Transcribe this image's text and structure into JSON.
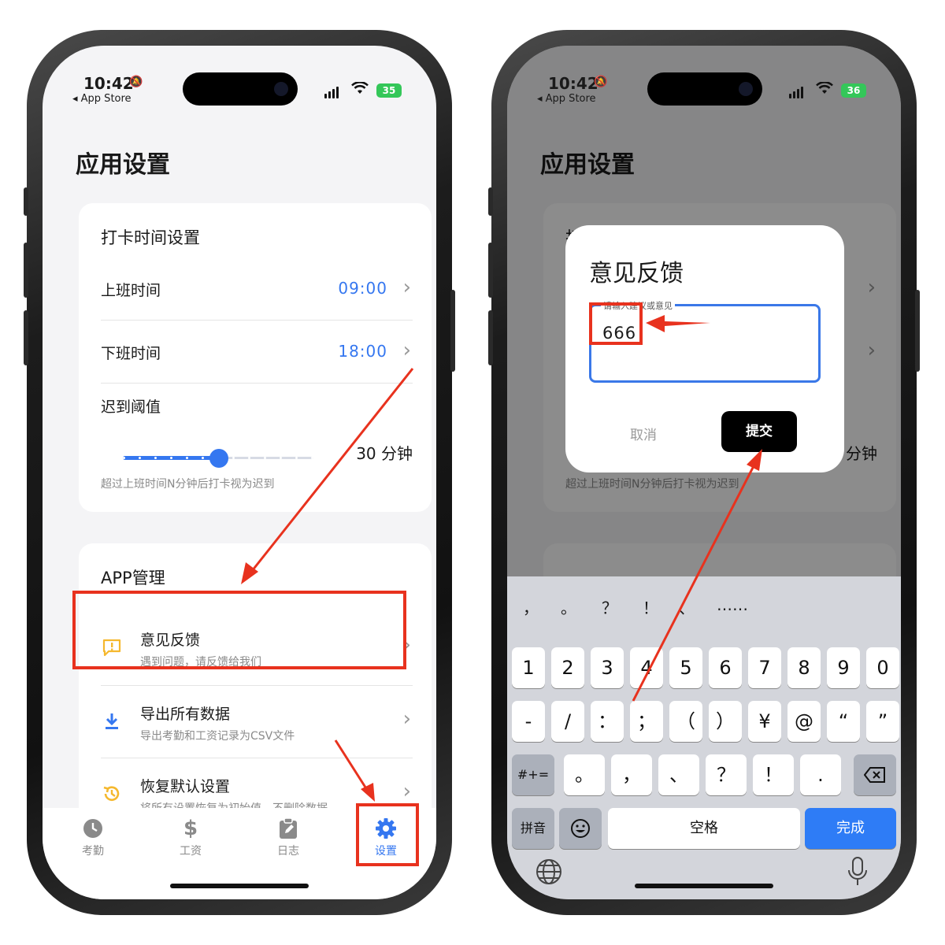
{
  "status_left": {
    "time": "10:42",
    "back": "◂ App Store",
    "battery": "35"
  },
  "status_right": {
    "time": "10:42",
    "back": "◂ App Store",
    "battery": "36"
  },
  "page": {
    "title": "应用设置"
  },
  "punch_card": {
    "title": "打卡时间设置",
    "rows": [
      {
        "label": "上班时间",
        "value": "09:00"
      },
      {
        "label": "下班时间",
        "value": "18:00"
      }
    ],
    "late": {
      "label": "迟到阈值",
      "value": "30 分钟",
      "hint": "超过上班时间N分钟后打卡视为迟到",
      "slider_fraction": 0.5
    }
  },
  "app_card": {
    "title": "APP管理",
    "items": [
      {
        "title": "意见反馈",
        "subtitle": "遇到问题，请反馈给我们"
      },
      {
        "title": "导出所有数据",
        "subtitle": "导出考勤和工资记录为CSV文件"
      },
      {
        "title": "恢复默认设置",
        "subtitle": "将所有设置恢复为初始值，不删除数据"
      }
    ]
  },
  "tabs": [
    {
      "label": "考勤"
    },
    {
      "label": "工资"
    },
    {
      "label": "日志"
    },
    {
      "label": "设置"
    }
  ],
  "dialog": {
    "title": "意见反馈",
    "field_label": "请输入建议或意见",
    "field_value": "666",
    "cancel": "取消",
    "submit": "提交"
  },
  "keyboard": {
    "candidates": [
      "，",
      "。",
      "？",
      "！",
      "、",
      "……"
    ],
    "row1": [
      "1",
      "2",
      "3",
      "4",
      "5",
      "6",
      "7",
      "8",
      "9",
      "0"
    ],
    "row2": [
      "-",
      "/",
      "：",
      "；",
      "（",
      "）",
      "¥",
      "@",
      "“",
      "”"
    ],
    "row3_left": "#+=",
    "row3": [
      "。",
      "，",
      "、",
      "？",
      "！",
      "."
    ],
    "pinyin": "拼音",
    "space": "空格",
    "done": "完成"
  },
  "colors": {
    "accent": "#3577f0",
    "highlight": "#e8321e",
    "feedback_icon": "#f5b82e"
  }
}
